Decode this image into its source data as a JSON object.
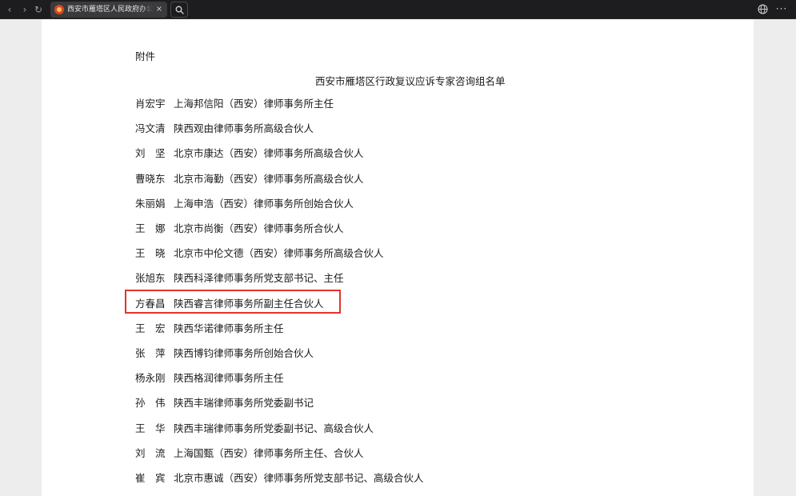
{
  "browser": {
    "tab_title": "西安市雁塔区人民政府办公室关于",
    "tab_close": "×",
    "nav": {
      "back": "‹",
      "forward": "›",
      "reload": "↻"
    },
    "more": "···",
    "icons": [
      "chevron-left-icon",
      "chevron-right-icon",
      "reload-icon",
      "gov-emblem-icon",
      "close-icon",
      "search-icon",
      "globe-icon",
      "more-icon"
    ]
  },
  "document": {
    "attachment_label": "附件",
    "title": "西安市雁塔区行政复议应诉专家咨询组名单",
    "members": [
      {
        "name": "肖宏宇",
        "org": "上海邦信阳（西安）律师事务所主任"
      },
      {
        "name": "冯文清",
        "org": "陕西观由律师事务所高级合伙人"
      },
      {
        "name": "刘　坚",
        "org": "北京市康达（西安）律师事务所高级合伙人"
      },
      {
        "name": "曹晓东",
        "org": "北京市海勤（西安）律师事务所高级合伙人"
      },
      {
        "name": "朱丽娟",
        "org": "上海申浩（西安）律师事务所创始合伙人"
      },
      {
        "name": "王　娜",
        "org": "北京市尚衡（西安）律师事务所合伙人"
      },
      {
        "name": "王　晓",
        "org": "北京市中伦文德（西安）律师事务所高级合伙人"
      },
      {
        "name": "张旭东",
        "org": "陕西科泽律师事务所党支部书记、主任"
      },
      {
        "name": "方春昌",
        "org": "陕西睿言律师事务所副主任合伙人"
      },
      {
        "name": "王　宏",
        "org": "陕西华诺律师事务所主任"
      },
      {
        "name": "张　萍",
        "org": "陕西博钧律师事务所创始合伙人"
      },
      {
        "name": "杨永刚",
        "org": "陕西格润律师事务所主任"
      },
      {
        "name": "孙　伟",
        "org": "陕西丰瑞律师事务所党委副书记"
      },
      {
        "name": "王　华",
        "org": "陕西丰瑞律师事务所党委副书记、高级合伙人"
      },
      {
        "name": "刘　流",
        "org": "上海国甄（西安）律师事务所主任、合伙人"
      },
      {
        "name": "崔　宾",
        "org": "北京市惠诚（西安）律师事务所党支部书记、高级合伙人"
      }
    ],
    "highlight_color": "#e0352b"
  }
}
